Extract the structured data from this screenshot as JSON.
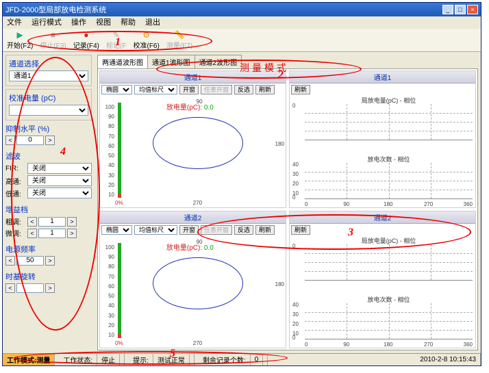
{
  "title": "JFD-2000型局部放电检测系统",
  "menu": [
    "文件",
    "运行模式",
    "操作",
    "视图",
    "帮助",
    "退出"
  ],
  "toolbar": [
    {
      "ico": "▶",
      "label": "开始(F2)",
      "enabled": true
    },
    {
      "ico": "■",
      "label": "停止(F3)",
      "enabled": false
    },
    {
      "ico": "●",
      "label": "记录(F4)",
      "enabled": true
    },
    {
      "ico": "✎",
      "label": "标记(F",
      "enabled": false
    },
    {
      "ico": "⚙",
      "label": "校准(F6)",
      "enabled": true
    },
    {
      "ico": "📏",
      "label": "测量(F7)",
      "enabled": false
    }
  ],
  "sidebar": {
    "channel_sel": {
      "title": "通道选择",
      "value": "通道1"
    },
    "calib": {
      "title": "校准电量 (pC)",
      "value": ""
    },
    "suppress": {
      "title": "抑制水平 (%)",
      "value": "0"
    },
    "filter": {
      "title": "滤波",
      "fir_label": "FIR:",
      "fir_val": "关闭",
      "hp_label": "高通:",
      "hp_val": "关闭",
      "lp_label": "低通:",
      "hp2_val": "关闭"
    },
    "gain": {
      "title": "增益档",
      "coarse_label": "粗调:",
      "coarse_val": "1",
      "fine_label": "微调:",
      "fine_val": "1"
    },
    "power": {
      "title": "电源频率",
      "value": "50"
    },
    "rot": {
      "title": "时基旋转",
      "value": ""
    }
  },
  "tabs": [
    "两通道波形图",
    "通道1波形图",
    "通道2波形图"
  ],
  "pane_titles": {
    "ch1": "通道1",
    "ch2": "通道2"
  },
  "ellipse_toolbar": {
    "shape": "椭圆",
    "ruler": "均值标尺",
    "window": "开窗",
    "any_window": "任意开窗",
    "invert": "反选",
    "refresh": "刷新"
  },
  "discharge_label": "放电量(pC):",
  "discharge_value": "0.0",
  "zero_pct": "0%",
  "yaxis_pct": [
    "100",
    "90",
    "80",
    "70",
    "60",
    "50",
    "40",
    "30",
    "20",
    "10"
  ],
  "angles": {
    "t": "90",
    "r": "180",
    "b": "270"
  },
  "right_refresh": "刷新",
  "right_charts": {
    "top": "局放电量(pC) - 相位",
    "bot": "放电次数 - 相位"
  },
  "right_y": [
    "0",
    "",
    "",
    "",
    ""
  ],
  "right_y2": [
    "40",
    "30",
    "20",
    "10",
    "0"
  ],
  "right_x": [
    "0",
    "90",
    "180",
    "270",
    "360"
  ],
  "status": {
    "mode_l": "工作模式:",
    "mode_v": "测量",
    "state_l": "工作状态:",
    "state_v": "停止",
    "tip_l": "提示:",
    "tip_v": "测试正常",
    "rec_l": "剩余记录个数:",
    "rec_v": "0",
    "time": "2010-2-8 10:15:43"
  },
  "annotations": {
    "mode_text": "测量模式",
    "nums": {
      "n1": "1",
      "n2": "2",
      "n3": "3",
      "n4": "4",
      "n5": "5"
    }
  }
}
